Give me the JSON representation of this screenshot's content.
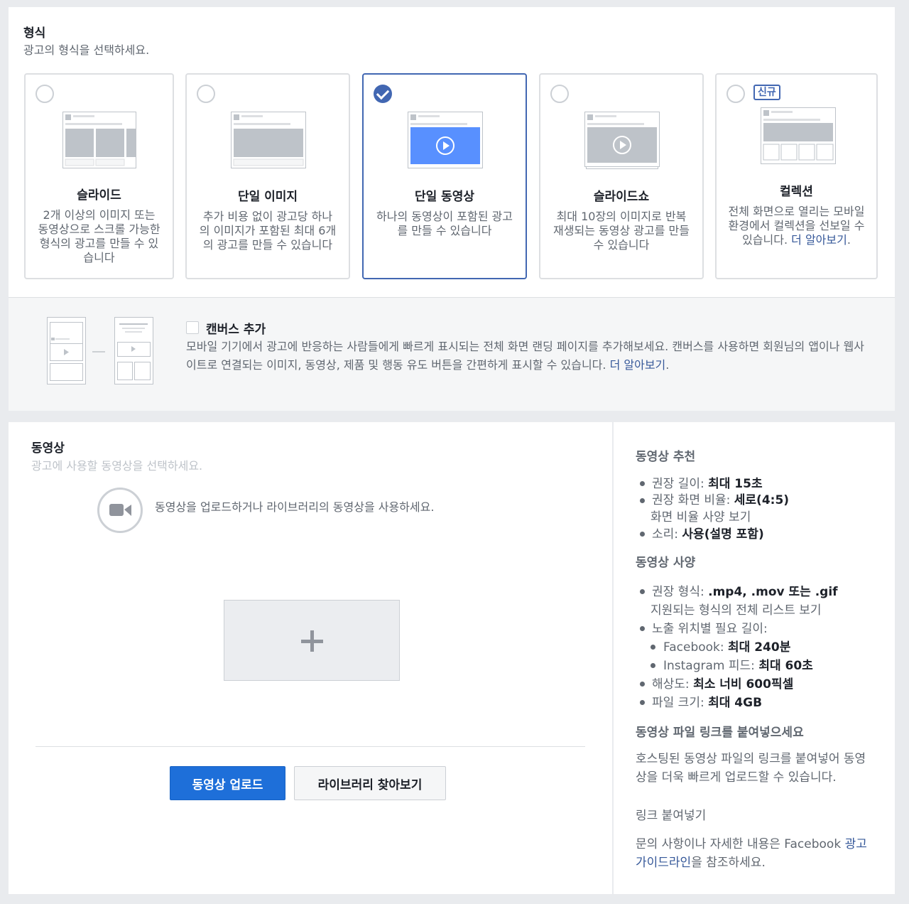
{
  "format": {
    "title": "형식",
    "subtitle": "광고의 형식을 선택하세요.",
    "cards": [
      {
        "title": "슬라이드",
        "desc": "2개 이상의 이미지 또는 동영상으로 스크롤 가능한 형식의 광고를 만들 수 있습니다",
        "selected": false
      },
      {
        "title": "단일 이미지",
        "desc": "추가 비용 없이 광고당 하나의 이미지가 포함된 최대 6개의 광고를 만들 수 있습니다",
        "selected": false
      },
      {
        "title": "단일 동영상",
        "desc": "하나의 동영상이 포함된 광고를 만들 수 있습니다",
        "selected": true
      },
      {
        "title": "슬라이드쇼",
        "desc": "최대 10장의 이미지로 반복 재생되는 동영상 광고를 만들 수 있습니다",
        "selected": false
      },
      {
        "title": "컬렉션",
        "desc": "전체 화면으로 열리는 모바일 환경에서 컬렉션을 선보일 수 있습니다.",
        "link": "더 알아보기",
        "suffix": ".",
        "badge": "신규",
        "selected": false
      }
    ]
  },
  "canvas": {
    "title": "캔버스 추가",
    "desc": "모바일 기기에서 광고에 반응하는 사람들에게 빠르게 표시되는 전체 화면 랜딩 페이지를 추가해보세요. 캔버스를 사용하면 회원님의 앱이나 웹사이트로 연결되는 이미지, 동영상, 제품 및 행동 유도 버튼을 간편하게 표시할 수 있습니다.",
    "link": "더 알아보기",
    "suffix": ".",
    "checked": false
  },
  "video": {
    "title": "동영상",
    "subtitle": "광고에 사용할 동영상을 선택하세요.",
    "recommendation": "동영상을 업로드하거나 라이브러리의 동영상을 사용하세요.",
    "upload_button": "동영상 업로드",
    "library_button": "라이브러리 찾아보기"
  },
  "side": {
    "rec_title": "동영상 추천",
    "length_label": "권장 길이:",
    "length_value": "최대 15초",
    "ratio_label": "권장 화면 비율:",
    "ratio_value": "세로(4:5)",
    "ratio_link": "화면 비율 사양 보기",
    "sound_label": "소리:",
    "sound_value": "사용(설명 포함)",
    "spec_title": "동영상 사양",
    "format_label": "권장 형식:",
    "format_value": ".mp4, .mov 또는 .gif",
    "format_link": "지원되는 형식의 전체 리스트 보기",
    "placement_label": "노출 위치별 필요 길이:",
    "fb_label": "Facebook:",
    "fb_value": "최대 240분",
    "ig_label": "Instagram 피드:",
    "ig_value": "최대 60초",
    "res_label": "해상도:",
    "res_value": "최소 너비 600픽셀",
    "size_label": "파일 크기:",
    "size_value": "최대 4GB",
    "link_title": "동영상 파일 링크를 붙여넣으세요",
    "link_desc": "호스팅된 동영상 파일의 링크를 붙여넣어 동영상을 더욱 빠르게 업로드할 수 있습니다.",
    "link_action": "링크 붙여넣기",
    "help_text": "문의 사항이나 자세한 내용은 Facebook",
    "help_link": "광고 가이드라인",
    "help_suffix": "을 참조하세요."
  }
}
